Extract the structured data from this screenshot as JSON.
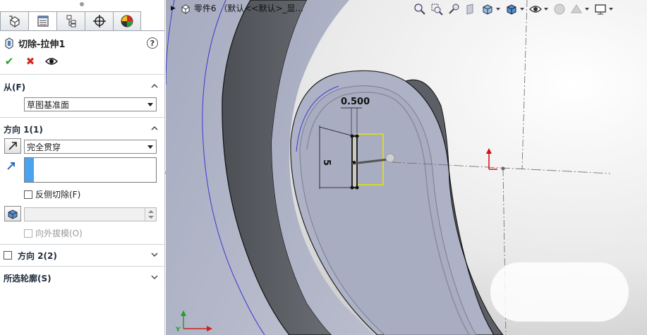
{
  "panel": {
    "tabs": [
      {
        "icon": "feature-manager-icon"
      },
      {
        "icon": "property-manager-icon",
        "active": true
      },
      {
        "icon": "configuration-manager-icon"
      },
      {
        "icon": "dimxpert-manager-icon"
      },
      {
        "icon": "display-manager-icon"
      }
    ],
    "title": "切除-拉伸1",
    "help": "?",
    "from": {
      "header": "从(F)",
      "value": "草图基准面"
    },
    "direction1": {
      "header": "方向 1(1)",
      "end_condition": "完全贯穿",
      "flip_side_label": "反侧切除(F)",
      "draft_outward_label": "向外拔模(O)"
    },
    "direction2": {
      "header": "方向 2(2)"
    },
    "contours": {
      "header": "所选轮廓(S)"
    }
  },
  "viewport": {
    "tree_label": "零件6 （默认<<默认>_显...",
    "dimension_width": "0.500",
    "dimension_height": "5",
    "colors": {
      "face": "#b4b8c8",
      "side": "#5f6267",
      "background_light": "#f2f2f2",
      "sketch_yellow": "#e6e600",
      "edge_blue": "#3333cc"
    }
  }
}
